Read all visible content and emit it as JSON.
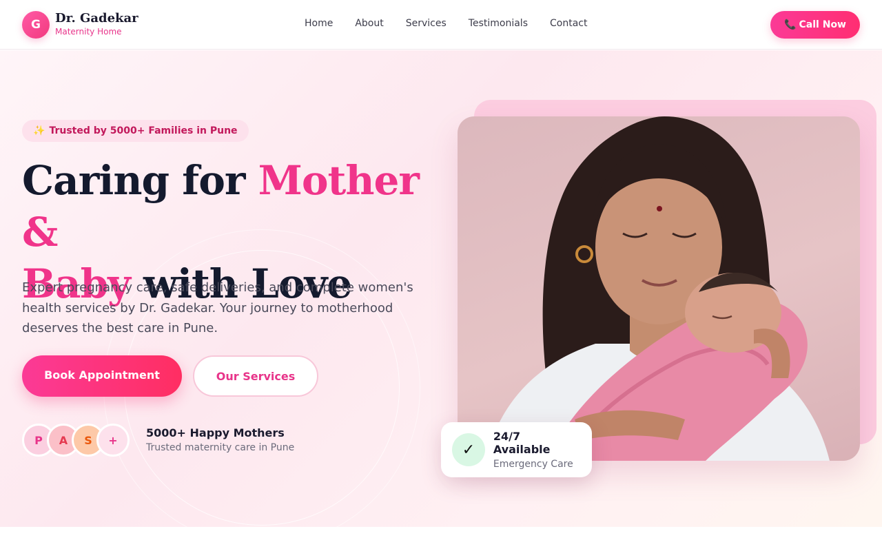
{
  "brand": {
    "logo_letter": "G",
    "name": "Dr. Gadekar",
    "subtitle": "Maternity Home"
  },
  "nav": {
    "links": [
      "Home",
      "About",
      "Services",
      "Testimonials",
      "Contact"
    ],
    "call_icon": "phone-icon",
    "call_glyph": "📞",
    "call_label": "Call Now"
  },
  "hero": {
    "badge_icon": "sparkles-icon",
    "badge_glyph": "✨",
    "badge_text": "Trusted by 5000+ Families in Pune",
    "headline": {
      "part1": "Caring for ",
      "highlight1": "Mother &",
      "highlight2": "Baby",
      "part2": " with Love"
    },
    "description": "Expert pregnancy care, safe deliveries, and complete women's health services by Dr. Gadekar. Your journey to motherhood deserves the best care in Pune.",
    "primary_button": "Book Appointment",
    "secondary_button": "Our Services",
    "avatars": [
      "P",
      "A",
      "S",
      "+"
    ],
    "proof_title": "5000+ Happy Mothers",
    "proof_subtitle": "Trusted maternity care in Pune"
  },
  "availability": {
    "icon": "check-icon",
    "glyph": "✓",
    "title": "24/7 Available",
    "subtitle": "Emergency Care"
  },
  "colors": {
    "accent": "#f0348a",
    "accent_gradient_end": "#ff2e62",
    "headline": "#141a2e",
    "badge_bg": "#fde1ec",
    "check_bg": "#d9f7e4"
  }
}
